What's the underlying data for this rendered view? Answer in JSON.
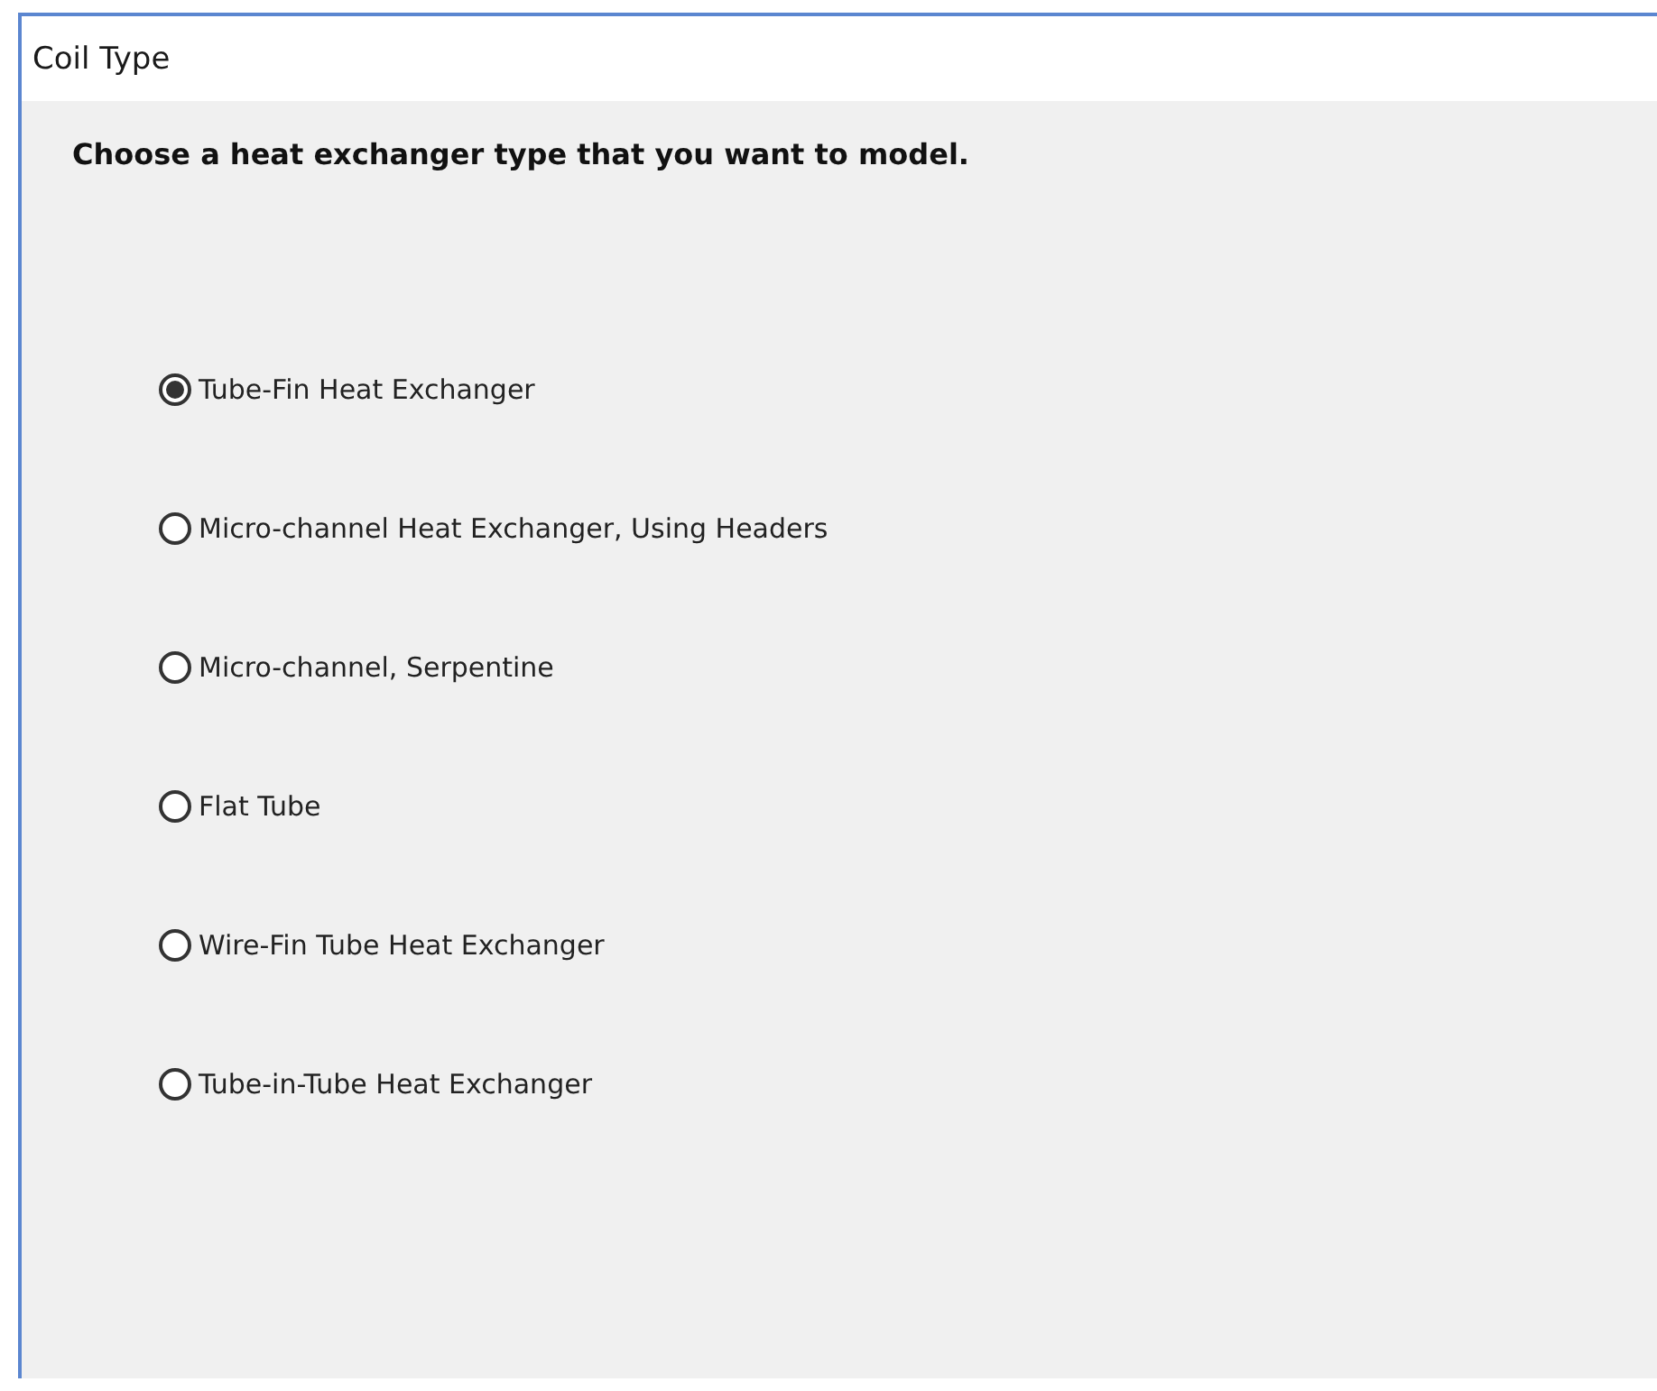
{
  "window": {
    "title": "Coil Type"
  },
  "prompt": "Choose a heat exchanger type that you want to model.",
  "options": [
    {
      "label": "Tube-Fin Heat Exchanger",
      "selected": true
    },
    {
      "label": "Micro-channel Heat Exchanger, Using Headers",
      "selected": false
    },
    {
      "label": "Micro-channel, Serpentine",
      "selected": false
    },
    {
      "label": "Flat Tube",
      "selected": false
    },
    {
      "label": "Wire-Fin Tube Heat Exchanger",
      "selected": false
    },
    {
      "label": "Tube-in-Tube Heat Exchanger",
      "selected": false
    }
  ]
}
